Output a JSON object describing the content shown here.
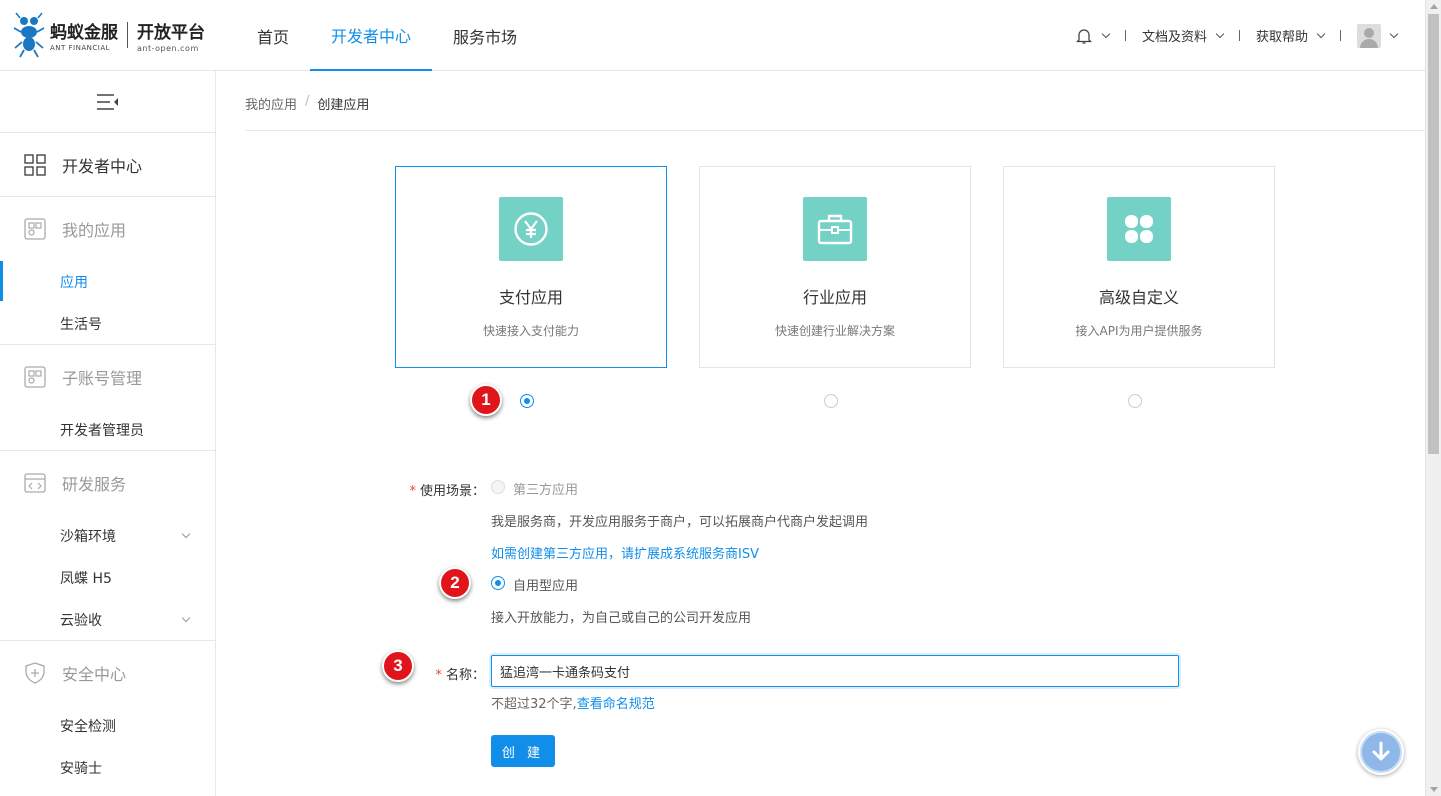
{
  "header": {
    "logo_cn": "蚂蚁金服",
    "logo_en": "ANT FINANCIAL",
    "platform_cn": "开放平台",
    "platform_url": "ant-open.com",
    "nav": [
      "首页",
      "开发者中心",
      "服务市场"
    ],
    "docs_label": "文档及资料",
    "help_label": "获取帮助"
  },
  "sidebar": {
    "dev_center": "开发者中心",
    "my_apps": "我的应用",
    "apps": "应用",
    "lifestyle": "生活号",
    "sub_accounts": "子账号管理",
    "dev_admin": "开发者管理员",
    "rd_services": "研发服务",
    "sandbox": "沙箱环境",
    "fengdie": "凤蝶 H5",
    "cloud_accept": "云验收",
    "security_center": "安全中心",
    "security_check": "安全检测",
    "anqishi": "安骑士"
  },
  "breadcrumb": {
    "parent": "我的应用",
    "separator": "/",
    "current": "创建应用"
  },
  "cards": [
    {
      "title": "支付应用",
      "desc": "快速接入支付能力",
      "icon": "yen-icon"
    },
    {
      "title": "行业应用",
      "desc": "快速创建行业解决方案",
      "icon": "briefcase-icon"
    },
    {
      "title": "高级自定义",
      "desc": "接入API为用户提供服务",
      "icon": "clover-icon"
    }
  ],
  "selected_card": 0,
  "form": {
    "scene_label": "使用场景：",
    "required_mark": "*",
    "third_party": "第三方应用",
    "third_party_desc": "我是服务商，开发应用服务于商户，可以拓展商户代商户发起调用",
    "third_party_link": "如需创建第三方应用，请扩展成系统服务商ISV",
    "self_use": "自用型应用",
    "self_use_desc": "接入开放能力，为自己或自己的公司开发应用",
    "name_label": "名称：",
    "name_value": "猛追湾一卡通条码支付",
    "name_hint": "不超过32个字,",
    "name_hint_link": "查看命名规范",
    "create_button": "创 建"
  },
  "annotations": [
    "1",
    "2",
    "3"
  ],
  "colors": {
    "primary": "#108ee9",
    "card_icon_bg": "#74d1c6",
    "annotation_red": "#e0141b"
  }
}
